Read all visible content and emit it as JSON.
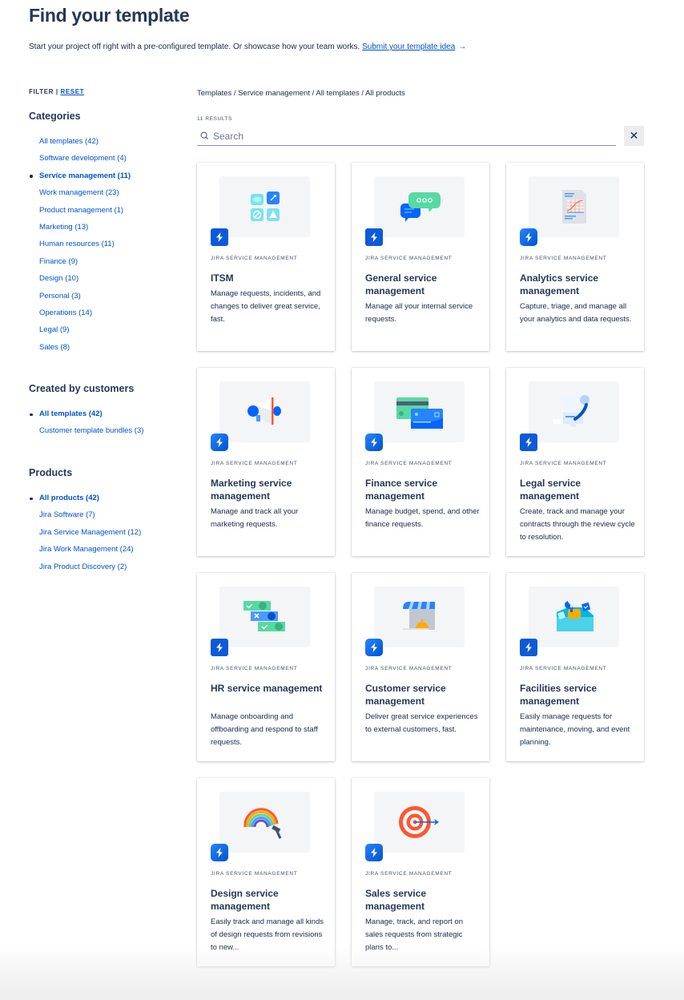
{
  "header": {
    "title": "Find your template",
    "intro": "Start your project off right with a pre-configured template. Or showcase how your team works.",
    "submit_link": "Submit your template idea",
    "submit_arrow": "→"
  },
  "filter": {
    "label": "FILTER",
    "separator": " | ",
    "reset": "RESET"
  },
  "sidebar": {
    "categories": {
      "heading": "Categories",
      "items": [
        {
          "label": "All templates (42)",
          "active": false
        },
        {
          "label": "Software development (4)",
          "active": false
        },
        {
          "label": "Service management (11)",
          "active": true
        },
        {
          "label": "Work management (23)",
          "active": false
        },
        {
          "label": "Product management (1)",
          "active": false
        },
        {
          "label": "Marketing (13)",
          "active": false
        },
        {
          "label": "Human resources (11)",
          "active": false
        },
        {
          "label": "Finance (9)",
          "active": false
        },
        {
          "label": "Design (10)",
          "active": false
        },
        {
          "label": "Personal (3)",
          "active": false
        },
        {
          "label": "Operations (14)",
          "active": false
        },
        {
          "label": "Legal (9)",
          "active": false
        },
        {
          "label": "Sales (8)",
          "active": false
        }
      ]
    },
    "created_by": {
      "heading": "Created by customers",
      "items": [
        {
          "label": "All templates (42)",
          "active": true
        },
        {
          "label": "Customer template bundles (3)",
          "active": false
        }
      ]
    },
    "products": {
      "heading": "Products",
      "items": [
        {
          "label": "All products (42)",
          "active": true
        },
        {
          "label": "Jira Software (7)",
          "active": false
        },
        {
          "label": "Jira Service Management (12)",
          "active": false
        },
        {
          "label": "Jira Work Management (24)",
          "active": false
        },
        {
          "label": "Jira Product Discovery (2)",
          "active": false
        }
      ]
    }
  },
  "main": {
    "breadcrumb": "Templates / Service management / All templates / All products",
    "results": "11 RESULTS",
    "search": {
      "placeholder": "Search",
      "value": "",
      "clear_label": "✕"
    },
    "cards": [
      {
        "product": "JIRA SERVICE MANAGEMENT",
        "title": "ITSM",
        "description": "Manage requests, incidents, and changes to deliver great service, fast.",
        "illustration": "itsm-workflow-icon"
      },
      {
        "product": "JIRA SERVICE MANAGEMENT",
        "title": "General service management",
        "description": "Manage all your internal service requests.",
        "illustration": "chat-bubbles-icon"
      },
      {
        "product": "JIRA SERVICE MANAGEMENT",
        "title": "Analytics service management",
        "description": "Capture, triage, and manage all your analytics and data requests.",
        "illustration": "analytics-report-icon"
      },
      {
        "product": "JIRA SERVICE MANAGEMENT",
        "title": "Marketing service management",
        "description": "Manage and track all your marketing requests.",
        "illustration": "megaphone-icon"
      },
      {
        "product": "JIRA SERVICE MANAGEMENT",
        "title": "Finance service management",
        "description": "Manage budget, spend, and other finance requests.",
        "illustration": "credit-cards-icon"
      },
      {
        "product": "JIRA SERVICE MANAGEMENT",
        "title": "Legal service management",
        "description": "Create, track and manage your contracts through the review cycle to resolution.",
        "illustration": "contract-quill-icon"
      },
      {
        "product": "JIRA SERVICE MANAGEMENT",
        "title": "HR service management",
        "description": "Manage onboarding and offboarding and respond to staff requests.",
        "illustration": "hr-approvals-icon"
      },
      {
        "product": "JIRA SERVICE MANAGEMENT",
        "title": "Customer service management",
        "description": "Deliver great service experiences to external customers, fast.",
        "illustration": "storefront-bell-icon"
      },
      {
        "product": "JIRA SERVICE MANAGEMENT",
        "title": "Facilities service management",
        "description": "Easily manage requests for maintenance, moving, and event planning.",
        "illustration": "toolbox-icon"
      },
      {
        "product": "JIRA SERVICE MANAGEMENT",
        "title": "Design service management",
        "description": "Easily track and manage all kinds of design requests from revisions to new...",
        "illustration": "rainbow-brush-icon"
      },
      {
        "product": "JIRA SERVICE MANAGEMENT",
        "title": "Sales service management",
        "description": "Manage, track, and report on sales requests from strategic plans to...",
        "illustration": "target-arrow-icon"
      }
    ]
  },
  "colors": {
    "link": "#0052cc",
    "heading": "#253858",
    "text": "#172b4d",
    "badge": "#0c5ad9",
    "thumb_bg": "#f4f5f7"
  }
}
